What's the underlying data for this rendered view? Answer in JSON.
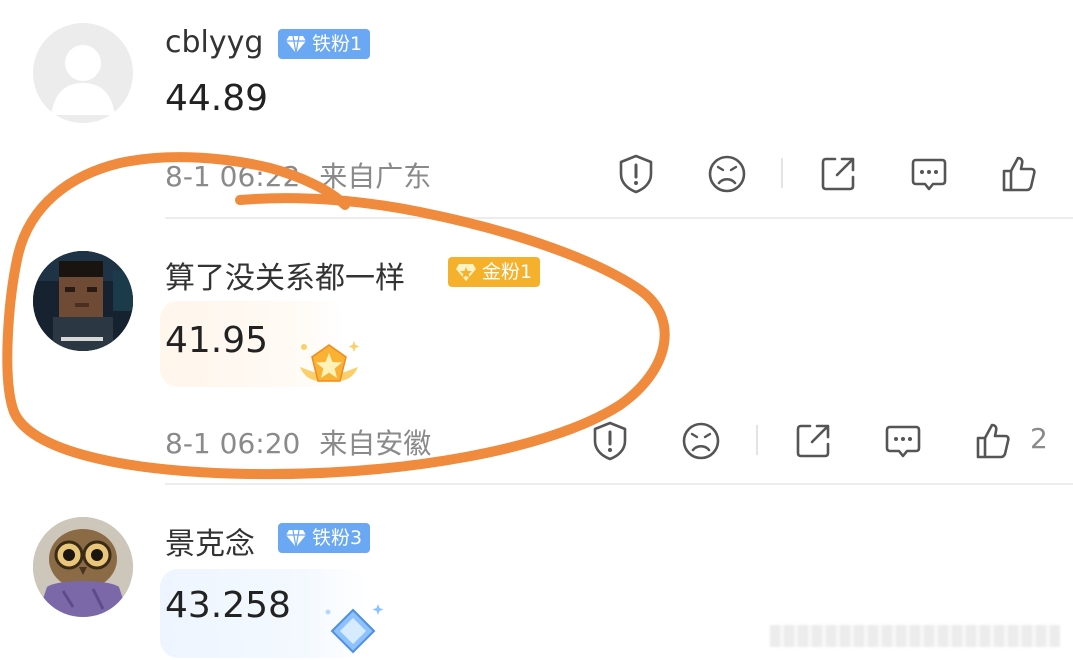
{
  "comments": [
    {
      "username": "cblyyg",
      "badge": "铁粉1",
      "badge_type": "iron",
      "text": "44.89",
      "time": "8-1 06:22",
      "location": "来自广东",
      "likes": ""
    },
    {
      "username": "算了没关系都一样",
      "badge": "金粉1",
      "badge_type": "gold",
      "text": "41.95",
      "time": "8-1 06:20",
      "location": "来自安徽",
      "likes": "2"
    },
    {
      "username": "景克念",
      "badge": "铁粉3",
      "badge_type": "iron",
      "text": "43.258"
    }
  ],
  "colors": {
    "iron_badge": "#6aa8f3",
    "gold_badge": "#f5b12b",
    "annotation_circle": "#f08a3c"
  },
  "icons": [
    "report-icon",
    "dislike-face-icon",
    "share-icon",
    "reply-icon",
    "like-icon"
  ]
}
